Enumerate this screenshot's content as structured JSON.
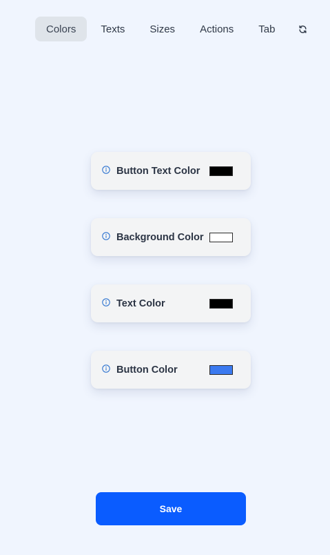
{
  "tabs": [
    {
      "label": "Colors",
      "active": true
    },
    {
      "label": "Texts"
    },
    {
      "label": "Sizes"
    },
    {
      "label": "Actions"
    },
    {
      "label": "Tab"
    }
  ],
  "refresh_icon": "refresh-icon",
  "color_settings": [
    {
      "label": "Button Text Color",
      "color": "#000000",
      "icon": "info-icon"
    },
    {
      "label": "Background Color",
      "color": "#ffffff",
      "icon": "info-icon"
    },
    {
      "label": "Text Color",
      "color": "#000000",
      "icon": "info-icon"
    },
    {
      "label": "Button Color",
      "color": "#3b7af0",
      "icon": "info-icon"
    }
  ],
  "save_label": "Save",
  "colors": {
    "page_background": "#f0f5fe",
    "primary": "#0a5cff",
    "info_icon": "#2f74d0"
  }
}
